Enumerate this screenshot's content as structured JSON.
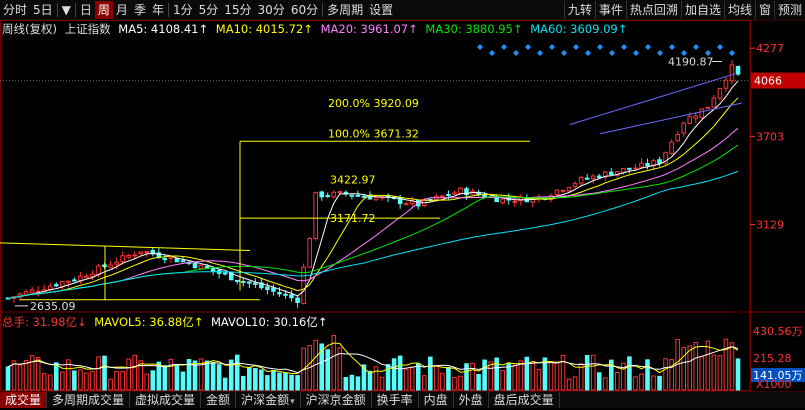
{
  "toolbar": {
    "left": [
      {
        "name": "tb-fenshi",
        "label": "分时"
      },
      {
        "name": "tb-5day",
        "label": "5日"
      },
      {
        "name": "tb-dropdown",
        "label": "▼"
      },
      {
        "name": "tb-day",
        "label": "日"
      },
      {
        "name": "tb-week",
        "label": "周",
        "active": true
      },
      {
        "name": "tb-month",
        "label": "月"
      },
      {
        "name": "tb-season",
        "label": "季"
      },
      {
        "name": "tb-year",
        "label": "年"
      },
      {
        "name": "tb-1min",
        "label": "1分"
      },
      {
        "name": "tb-5min",
        "label": "5分"
      },
      {
        "name": "tb-15min",
        "label": "15分"
      },
      {
        "name": "tb-30min",
        "label": "30分"
      },
      {
        "name": "tb-60min",
        "label": "60分"
      },
      {
        "name": "tb-multi",
        "label": "多周期"
      },
      {
        "name": "tb-settings",
        "label": "设置"
      }
    ],
    "right": [
      {
        "name": "tb-jiuzhuan",
        "label": "九转"
      },
      {
        "name": "tb-event",
        "label": "事件"
      },
      {
        "name": "tb-review",
        "label": "热点回溯"
      },
      {
        "name": "tb-watchlist",
        "label": "加自选"
      },
      {
        "name": "tb-ma",
        "label": "均线"
      },
      {
        "name": "tb-window",
        "label": "窗"
      },
      {
        "name": "tb-forecast",
        "label": "预测"
      }
    ]
  },
  "info": {
    "title": "周线(复权)",
    "index": "上证指数",
    "ma5": "MA5: 4108.41↑",
    "ma10": "MA10: 4015.72↑",
    "ma20": "MA20: 3961.07↑",
    "ma30": "MA30: 3880.95↑",
    "ma60": "MA60: 3609.09↑"
  },
  "colors": {
    "up": "#ff3232",
    "down": "#54fcfc",
    "ma5": "#ffffff",
    "ma10": "#ffff00",
    "ma20": "#ff80ff",
    "ma30": "#00e600",
    "ma60": "#02e2f4",
    "fib": "#ffff00",
    "diamond": "#1e90ff",
    "price": "#ff3232",
    "grid": "#7a0000"
  },
  "price_axis": {
    "ticks": [
      {
        "value": 4277,
        "label": "4277"
      },
      {
        "value": 3703,
        "label": "3703"
      },
      {
        "value": 3129,
        "label": "3129"
      }
    ],
    "current": {
      "value": 4066,
      "label": "4066"
    }
  },
  "annotations": {
    "high": "4190.87",
    "low": "2635.09",
    "fib200": "200.0%  3920.09",
    "fib100": "100.0%  3671.32",
    "fibmid": "3422.97",
    "fiblow": "3171.72"
  },
  "volume": {
    "label": "总手: 31.98亿↓",
    "mavol5": "MAVOL5: 36.88亿↑",
    "mavol10": "MAVOL10: 30.16亿↑",
    "axis_top": "430.56万",
    "axis_mid": "215.28",
    "axis_current": "141.05万",
    "axis_unit": "X1000"
  },
  "bottom_tabs": [
    {
      "name": "tab-volume",
      "label": "成交量",
      "active": true
    },
    {
      "name": "tab-multi-volume",
      "label": "多周期成交量"
    },
    {
      "name": "tab-virtual-volume",
      "label": "虚拟成交量"
    },
    {
      "name": "tab-amount",
      "label": "金额"
    },
    {
      "name": "tab-hs-amount",
      "label": "沪深金额",
      "caret": true
    },
    {
      "name": "tab-hsj-amount",
      "label": "沪深京金额"
    },
    {
      "name": "tab-turnover",
      "label": "换手率"
    },
    {
      "name": "tab-inner",
      "label": "内盘"
    },
    {
      "name": "tab-outer",
      "label": "外盘"
    },
    {
      "name": "tab-afterhours",
      "label": "盘后成交量"
    }
  ]
}
